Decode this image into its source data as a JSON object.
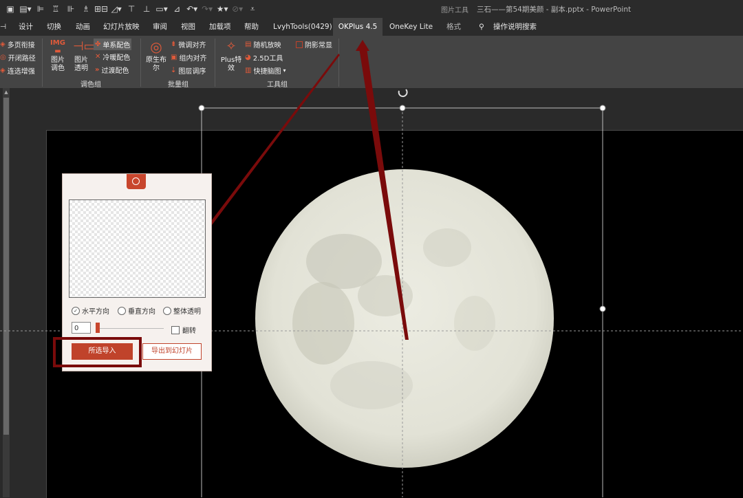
{
  "app": {
    "context_tab": "图片工具",
    "doc_title": "三石——第54期美颜 - 副本.pptx  -  PowerPoint"
  },
  "tabs": [
    {
      "label": "设计"
    },
    {
      "label": "切换"
    },
    {
      "label": "动画"
    },
    {
      "label": "幻灯片放映"
    },
    {
      "label": "审阅"
    },
    {
      "label": "视图"
    },
    {
      "label": "加载项"
    },
    {
      "label": "帮助"
    },
    {
      "label": "LvyhTools(0429)"
    },
    {
      "label": "OKPlus 4.5"
    },
    {
      "label": "OneKey Lite"
    },
    {
      "label": "格式"
    },
    {
      "label": "操作说明搜索"
    }
  ],
  "ribbon": {
    "left_cut": [
      "多页衔接",
      "开闭路径",
      "连选增强"
    ],
    "color_group": {
      "label": "调色组",
      "img_badge": "IMG",
      "pic_adjust": "图片\n调色",
      "pic_transparent": "图片\n透明",
      "single_color": "单系配色",
      "cool_warm": "冷暖配色",
      "transition": "过渡配色"
    },
    "batch_group": {
      "label": "批量组",
      "boolean": "原生布\n尔",
      "fine_align": "微调对齐",
      "group_align": "组内对齐",
      "layer_order": "图层调序"
    },
    "tool_group": {
      "label": "工具组",
      "plus_effect": "Plus特\n效",
      "random_zoom": "随机放映",
      "tool_25d": "2.5D工具",
      "quick_brain": "快捷脑图",
      "shadow_fixed": "阴影常显"
    }
  },
  "dialog": {
    "horizontal": "水平方向",
    "vertical": "垂直方向",
    "overall": "整体透明",
    "value": "0",
    "flip": "翻转",
    "import_btn": "所选导入",
    "export_btn": "导出到幻灯片"
  },
  "colors": {
    "accent": "#c0432b",
    "arrow": "#7a0b0b",
    "moon": "#e6e6dc"
  }
}
